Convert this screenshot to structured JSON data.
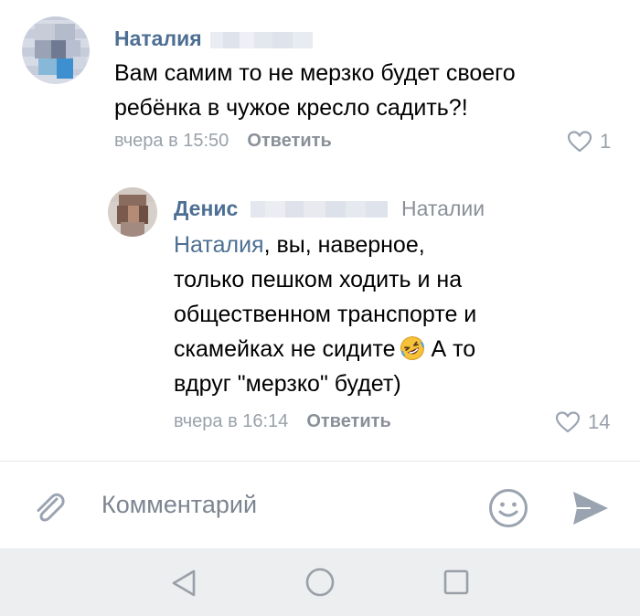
{
  "comments": [
    {
      "author": "Наталия",
      "text": "Вам самим то не мерзко будет своего ребёнка в чужое кресло садить?!",
      "time": "вчера в 15:50",
      "reply_label": "Ответить",
      "likes": "1"
    },
    {
      "author": "Денис",
      "reply_to": "Наталии",
      "mention": "Наталия",
      "text_line1": ", вы, наверное,",
      "text_line2": "только пешком ходить и на",
      "text_line3": "общественном транспорте и",
      "text_line4": "скамейках не сидите",
      "text_line4b": " А то",
      "text_line5": "вдруг \"мерзко\" будет)",
      "emoji": "rolling-on-floor-laughing",
      "time": "вчера в 16:14",
      "reply_label": "Ответить",
      "likes": "14"
    }
  ],
  "composer": {
    "placeholder": "Комментарий",
    "attach_icon": "paperclip-icon",
    "emoji_icon": "smiley-icon",
    "send_icon": "send-icon"
  },
  "navigation": {
    "back_icon": "triangle-back-icon",
    "home_icon": "circle-home-icon",
    "recents_icon": "square-recents-icon"
  },
  "colors": {
    "link": "#4d6f93",
    "meta": "#9aa1aa",
    "icon": "#9aa4b0",
    "navbar": "#eceef0"
  }
}
